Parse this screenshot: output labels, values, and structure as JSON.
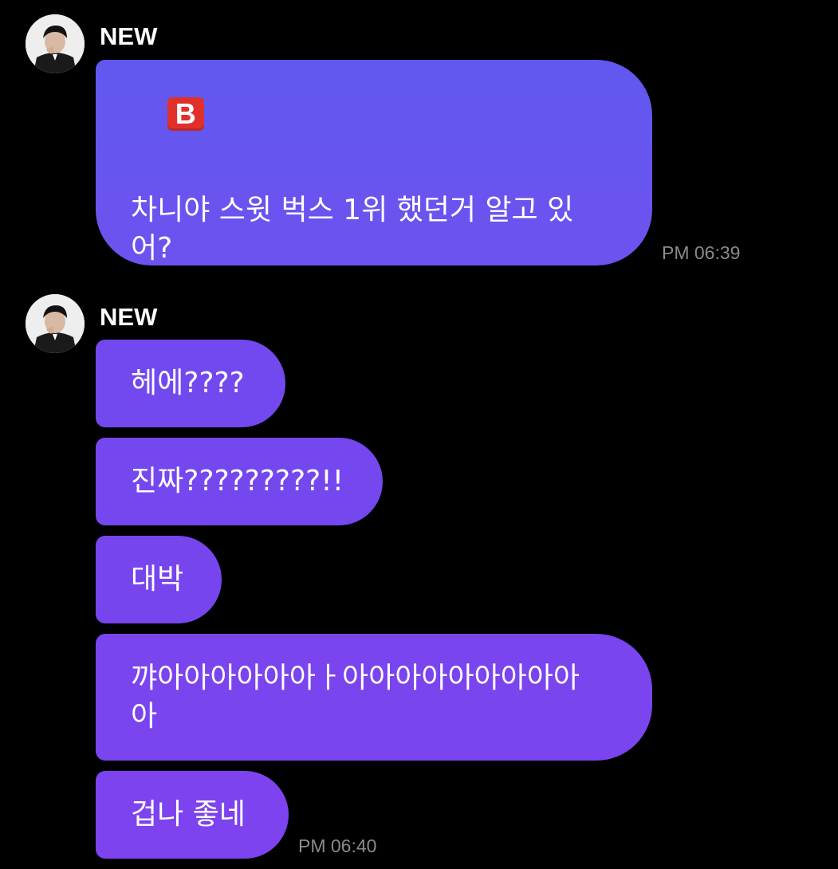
{
  "groups": [
    {
      "sender": "NEW",
      "messages": [
        {
          "icon": "B",
          "text": "차니야 스윗 벅스 1위 했던거 알고 있\n어?"
        }
      ],
      "time": "PM 06:39"
    },
    {
      "sender": "NEW",
      "messages": [
        {
          "text": "헤에????"
        },
        {
          "text": "진짜?????????!!"
        },
        {
          "text": "대박"
        },
        {
          "text": "꺄아아아아아아ㅏ아아아아아아아아아\n아"
        },
        {
          "text": "겁나 좋네"
        }
      ],
      "time": "PM 06:40"
    }
  ],
  "colors": {
    "background": "#000000",
    "bubble": "#7149ee",
    "timestamp": "#8a8a8a",
    "b_icon": "#e0302c"
  }
}
